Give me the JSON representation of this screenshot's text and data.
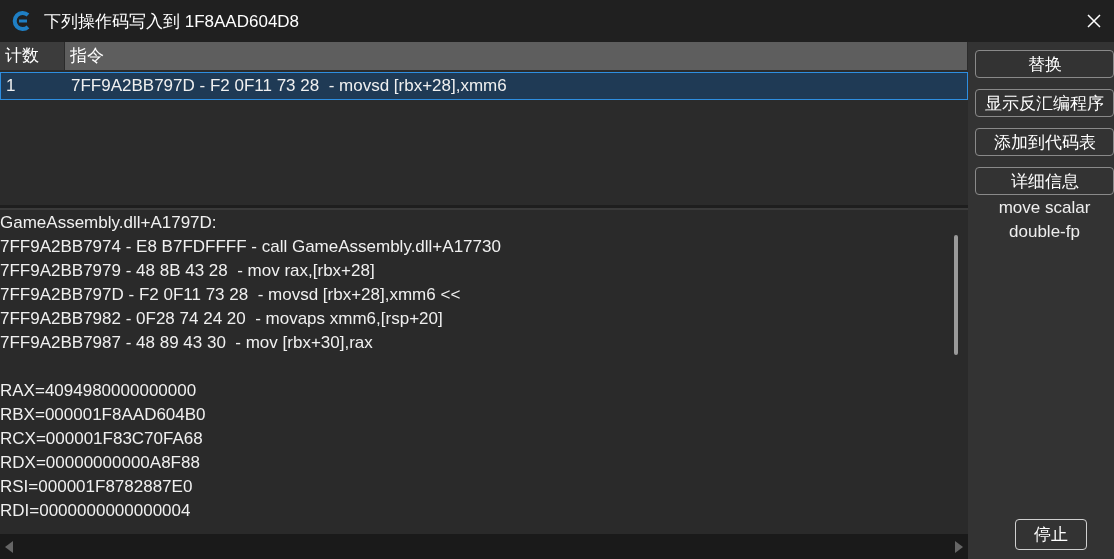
{
  "window": {
    "title": "下列操作码写入到 1F8AAD604D8"
  },
  "table": {
    "columns": [
      "计数",
      "指令"
    ],
    "rows": [
      {
        "cells": [
          "1",
          "7FF9A2BB797D - F2 0F11 73 28  - movsd [rbx+28],xmm6"
        ],
        "selected": true
      }
    ]
  },
  "disassembly": {
    "lines": [
      "GameAssembly.dll+A1797D:",
      "7FF9A2BB7974 - E8 B7FDFFFF - call GameAssembly.dll+A17730",
      "7FF9A2BB7979 - 48 8B 43 28  - mov rax,[rbx+28]",
      "7FF9A2BB797D - F2 0F11 73 28  - movsd [rbx+28],xmm6 <<",
      "7FF9A2BB7982 - 0F28 74 24 20  - movaps xmm6,[rsp+20]",
      "7FF9A2BB7987 - 48 89 43 30  - mov [rbx+30],rax"
    ],
    "registers": [
      "RAX=4094980000000000",
      "RBX=000001F8AAD604B0",
      "RCX=000001F83C70FA68",
      "RDX=00000000000A8F88",
      "RSI=000001F8782887E0",
      "RDI=0000000000000004"
    ]
  },
  "buttons": [
    "替换",
    "显示反汇编程序",
    "添加到代码表",
    "详细信息"
  ],
  "description": "move scalar double-fp",
  "stop_button": "停止"
}
